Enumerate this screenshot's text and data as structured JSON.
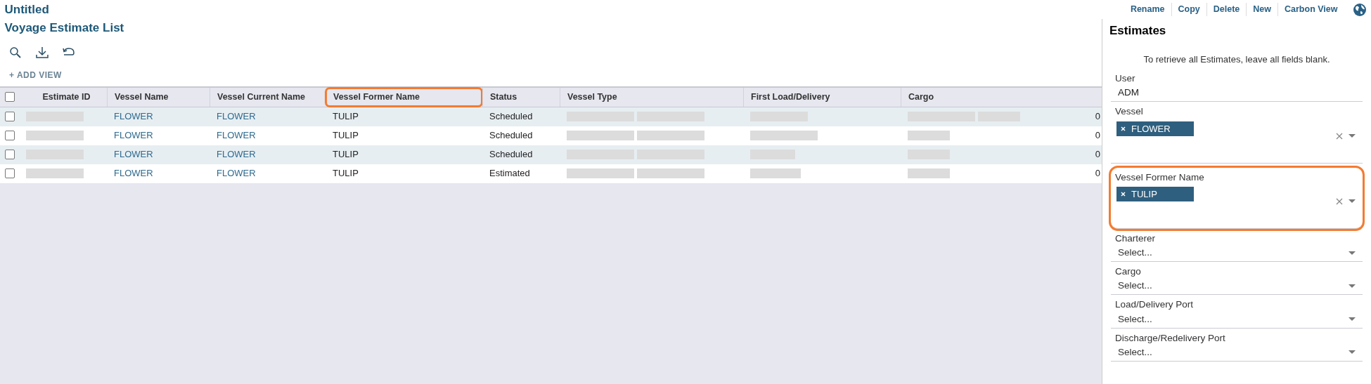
{
  "window": {
    "title": "Untitled"
  },
  "toolbar": [
    {
      "label": "Rename"
    },
    {
      "label": "Copy"
    },
    {
      "label": "Delete"
    },
    {
      "label": "New"
    },
    {
      "label": "Carbon View"
    }
  ],
  "list": {
    "title": "Voyage Estimate List",
    "add_view": "+ ADD VIEW",
    "select_all": {
      "checked": false
    },
    "columns": [
      {
        "label": "Estimate ID",
        "highlighted": false
      },
      {
        "label": "Vessel Name",
        "highlighted": false
      },
      {
        "label": "Vessel Current Name",
        "highlighted": false
      },
      {
        "label": "Vessel Former Name",
        "highlighted": true
      },
      {
        "label": "Status",
        "highlighted": false
      },
      {
        "label": "Vessel Type",
        "highlighted": false
      },
      {
        "label": "First Load/Delivery",
        "highlighted": false
      },
      {
        "label": "Cargo",
        "highlighted": false
      }
    ],
    "rows": [
      {
        "checked": false,
        "cells": [
          {
            "kind": "redacted"
          },
          {
            "kind": "link",
            "text": "FLOWER"
          },
          {
            "kind": "link",
            "text": "FLOWER"
          },
          {
            "kind": "text",
            "text": "TULIP"
          },
          {
            "kind": "text",
            "text": "Scheduled"
          },
          {
            "kind": "redacted"
          },
          {
            "kind": "redacted"
          },
          {
            "kind": "redacted",
            "tail": "0"
          }
        ]
      },
      {
        "checked": false,
        "cells": [
          {
            "kind": "redacted"
          },
          {
            "kind": "link",
            "text": "FLOWER"
          },
          {
            "kind": "link",
            "text": "FLOWER"
          },
          {
            "kind": "text",
            "text": "TULIP"
          },
          {
            "kind": "text",
            "text": "Scheduled"
          },
          {
            "kind": "redacted"
          },
          {
            "kind": "redacted"
          },
          {
            "kind": "redacted",
            "tail": "0"
          }
        ]
      },
      {
        "checked": false,
        "cells": [
          {
            "kind": "redacted"
          },
          {
            "kind": "link",
            "text": "FLOWER"
          },
          {
            "kind": "link",
            "text": "FLOWER"
          },
          {
            "kind": "text",
            "text": "TULIP"
          },
          {
            "kind": "text",
            "text": "Scheduled"
          },
          {
            "kind": "redacted"
          },
          {
            "kind": "redacted"
          },
          {
            "kind": "redacted",
            "tail": "0"
          }
        ]
      },
      {
        "checked": false,
        "cells": [
          {
            "kind": "redacted"
          },
          {
            "kind": "link",
            "text": "FLOWER"
          },
          {
            "kind": "link",
            "text": "FLOWER"
          },
          {
            "kind": "text",
            "text": "TULIP"
          },
          {
            "kind": "text",
            "text": "Estimated"
          },
          {
            "kind": "redacted"
          },
          {
            "kind": "redacted"
          },
          {
            "kind": "redacted",
            "tail": "0"
          }
        ]
      }
    ]
  },
  "panel": {
    "title": "Estimates",
    "hint": "To retrieve all Estimates, leave all fields blank.",
    "filters": [
      {
        "kind": "text",
        "label": "User",
        "value": "ADM",
        "highlighted": false
      },
      {
        "kind": "multi",
        "label": "Vessel",
        "tags": [
          "FLOWER"
        ],
        "highlighted": false
      },
      {
        "kind": "multi",
        "label": "Vessel Former Name",
        "tags": [
          "TULIP"
        ],
        "highlighted": true
      },
      {
        "kind": "select",
        "label": "Charterer",
        "placeholder": "Select...",
        "highlighted": false
      },
      {
        "kind": "select",
        "label": "Cargo",
        "placeholder": "Select...",
        "highlighted": false
      },
      {
        "kind": "select",
        "label": "Load/Delivery Port",
        "placeholder": "Select...",
        "highlighted": false
      },
      {
        "kind": "select",
        "label": "Discharge/Redelivery Port",
        "placeholder": "Select...",
        "highlighted": false
      }
    ]
  }
}
